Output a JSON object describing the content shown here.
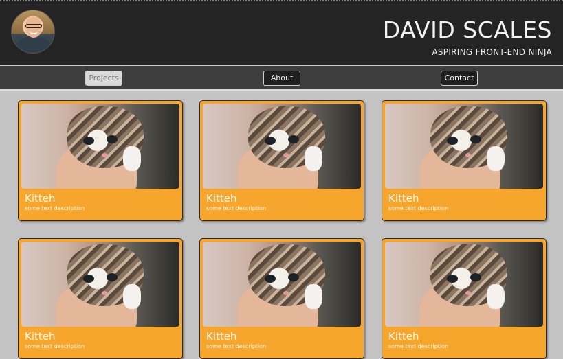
{
  "header": {
    "title": "DAVID SCALES",
    "subtitle": "ASPIRING FRONT-END NINJA",
    "background": "#242424"
  },
  "nav": {
    "items": [
      {
        "label": "Projects",
        "active": true
      },
      {
        "label": "About",
        "active": false
      },
      {
        "label": "Contact",
        "active": false
      }
    ]
  },
  "cards": [
    {
      "title": "Kitteh",
      "description": "some text description"
    },
    {
      "title": "Kitteh",
      "description": "some text description"
    },
    {
      "title": "Kitteh",
      "description": "some text description"
    },
    {
      "title": "Kitteh",
      "description": "some text description"
    },
    {
      "title": "Kitteh",
      "description": "some text description"
    },
    {
      "title": "Kitteh",
      "description": "some text description"
    }
  ],
  "colors": {
    "card_accent": "#f6a62c",
    "page_background": "#c3c3c3"
  }
}
